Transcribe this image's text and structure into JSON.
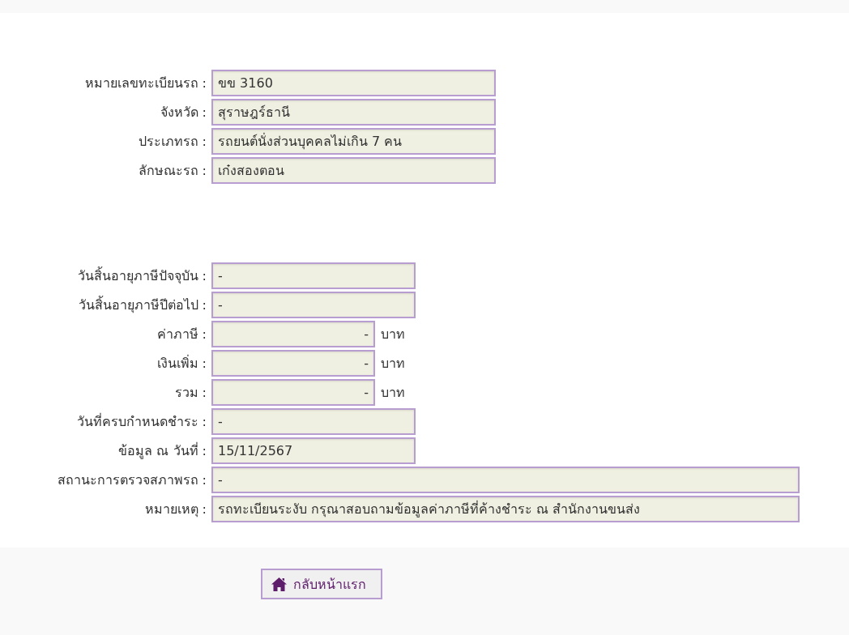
{
  "sections": [
    {
      "fields": [
        {
          "label": "หมายเลขทะเบียนรถ :",
          "value": "ขข 3160",
          "kind": "wide"
        },
        {
          "label": "จังหวัด :",
          "value": "สุราษฎร์ธานี",
          "kind": "wide"
        },
        {
          "label": "ประเภทรถ :",
          "value": "รถยนต์นั่งส่วนบุคคลไม่เกิน 7 คน",
          "kind": "wide"
        },
        {
          "label": "ลักษณะรถ :",
          "value": "เก๋งสองตอน",
          "kind": "wide"
        }
      ]
    },
    {
      "fields": [
        {
          "label": "วันสิ้นอายุภาษีปัจจุบัน :",
          "value": "-",
          "kind": "date"
        },
        {
          "label": "วันสิ้นอายุภาษีปีต่อไป :",
          "value": "-",
          "kind": "date"
        },
        {
          "label": "ค่าภาษี :",
          "value": "-",
          "kind": "money",
          "unit": "บาท"
        },
        {
          "label": "เงินเพิ่ม :",
          "value": "-",
          "kind": "money",
          "unit": "บาท"
        },
        {
          "label": "รวม :",
          "value": "-",
          "kind": "money",
          "unit": "บาท"
        },
        {
          "label": "วันที่ครบกำหนดชำระ :",
          "value": "-",
          "kind": "date"
        },
        {
          "label": "ข้อมูล ณ วันที่ :",
          "value": "15/11/2567",
          "kind": "date"
        },
        {
          "label": "สถานะการตรวจสภาพรถ :",
          "value": "-",
          "kind": "full"
        },
        {
          "label": "หมายเหตุ :",
          "value": "รถทะเบียนระงับ กรุณาสอบถามข้อมูลค่าภาษีที่ค้างชำระ ณ สำนักงานขนส่ง",
          "kind": "full"
        }
      ]
    }
  ],
  "back_button": {
    "label": "กลับหน้าแรก"
  }
}
